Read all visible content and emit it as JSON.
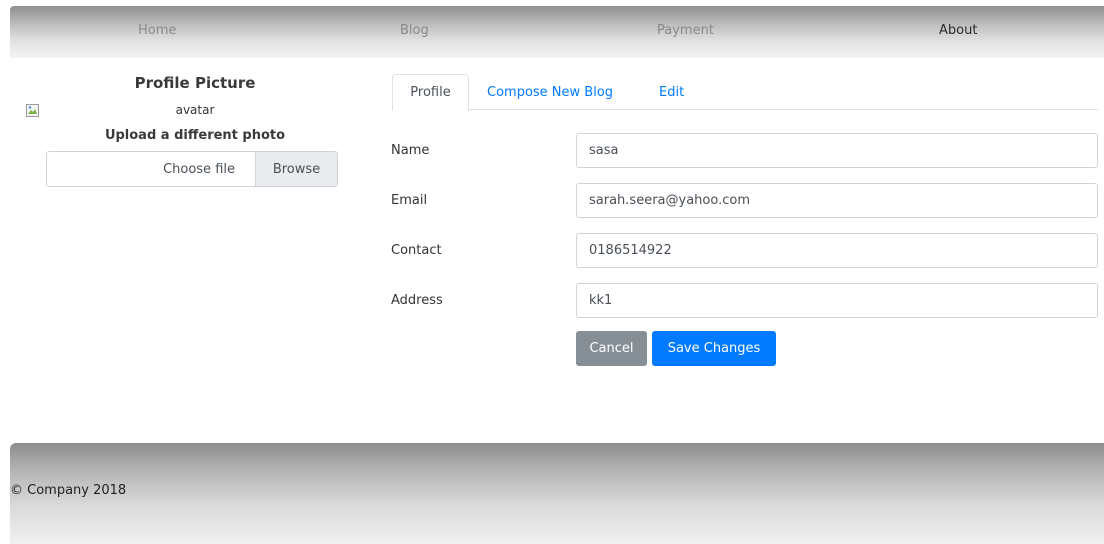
{
  "nav": {
    "items": [
      {
        "label": "Home"
      },
      {
        "label": "Blog"
      },
      {
        "label": "Payment"
      },
      {
        "label": "About"
      }
    ],
    "active": "About"
  },
  "profile_picture": {
    "title": "Profile Picture",
    "avatar_alt": "avatar",
    "upload_label": "Upload a different photo",
    "file_placeholder": "Choose file",
    "browse_label": "Browse"
  },
  "tabs": [
    {
      "label": "Profile",
      "active": true
    },
    {
      "label": "Compose New Blog",
      "active": false
    },
    {
      "label": "Edit",
      "active": false
    }
  ],
  "form": {
    "fields": [
      {
        "label": "Name",
        "value": "sasa"
      },
      {
        "label": "Email",
        "value": "sarah.seera@yahoo.com"
      },
      {
        "label": "Contact",
        "value": "0186514922"
      },
      {
        "label": "Address",
        "value": "kk1"
      }
    ],
    "cancel_label": "Cancel",
    "save_label": "Save Changes"
  },
  "footer": {
    "copyright": "© Company 2018"
  },
  "colors": {
    "primary": "#007bff",
    "secondary": "#868e96"
  }
}
